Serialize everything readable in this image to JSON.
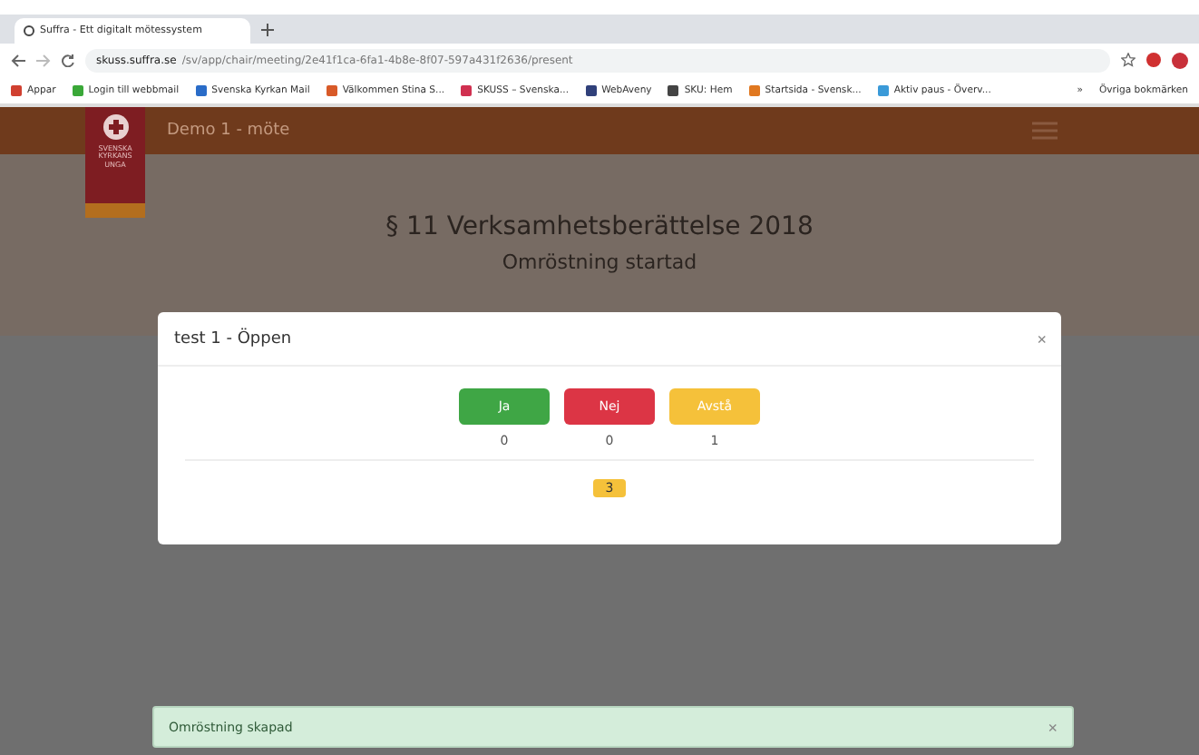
{
  "browser": {
    "tab_title": "Suffra - Ett digitalt mötessystem",
    "url_host": "skuss.suffra.se",
    "url_path": "/sv/app/chair/meeting/2e41f1ca-6fa1-4b8e-8f07-597a431f2636/present",
    "bookmarks": [
      {
        "label": "Appar",
        "color": "#d04030"
      },
      {
        "label": "Login till webbmail",
        "color": "#3aa838"
      },
      {
        "label": "Svenska Kyrkan Mail",
        "color": "#2a6cc8"
      },
      {
        "label": "Välkommen Stina S...",
        "color": "#d85a28"
      },
      {
        "label": "SKUSS – Svenska...",
        "color": "#d03050"
      },
      {
        "label": "WebAveny",
        "color": "#30407a"
      },
      {
        "label": "SKU: Hem",
        "color": "#444444"
      },
      {
        "label": "Startsida - Svensk...",
        "color": "#e07820"
      },
      {
        "label": "Aktiv paus - Överv...",
        "color": "#3a9ad8"
      }
    ],
    "more": "»",
    "other_bookmarks": "Övriga bokmärken"
  },
  "header": {
    "logo_text": "SVENSKA KYRKANS UNGA",
    "meeting": "Demo 1 - möte"
  },
  "page": {
    "title": "§ 11 Verksamhetsberättelse 2018",
    "subtitle": "Omröstning startad"
  },
  "modal": {
    "title": "test 1 - Öppen",
    "close": "×",
    "options": [
      {
        "label": "Ja",
        "count": "0",
        "color": "#3fa645"
      },
      {
        "label": "Nej",
        "count": "0",
        "color": "#dc3545"
      },
      {
        "label": "Avstå",
        "count": "1",
        "color": "#f5c13a"
      }
    ],
    "total": "3"
  },
  "toast": {
    "text": "Omröstning skapad",
    "close": "×"
  }
}
